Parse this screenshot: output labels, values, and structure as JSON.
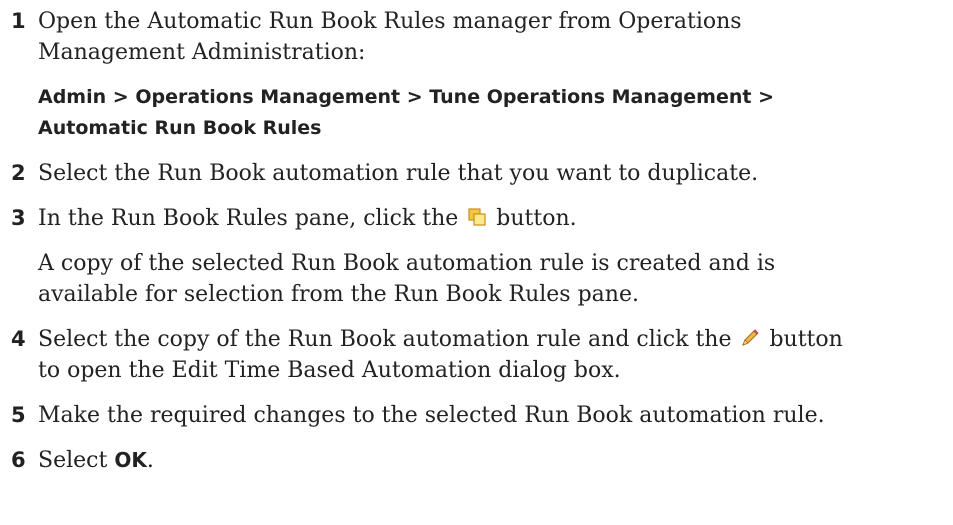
{
  "steps": [
    {
      "num": "1",
      "text_line1": "Open the Automatic Run Book Rules manager from Operations",
      "text_line2": "Management Administration:",
      "path": {
        "a": "Admin",
        "sep": " > ",
        "b": "Operations Management",
        "c": "Tune Operations Management",
        "d": "Automatic Run Book Rules"
      }
    },
    {
      "num": "2",
      "text": "Select the Run Book automation rule that you want to duplicate."
    },
    {
      "num": "3",
      "text_before": "In the Run Book Rules pane, click the ",
      "icon": "duplicate-icon",
      "text_after": " button.",
      "note_line1": "A copy of the selected Run Book automation rule is created and is",
      "note_line2": "available for selection from the Run Book Rules pane."
    },
    {
      "num": "4",
      "text_before": "Select the copy of the Run Book automation rule and click the ",
      "icon": "edit-pencil-icon",
      "text_after": " button",
      "text_line2": "to open the Edit Time Based Automation dialog box."
    },
    {
      "num": "5",
      "text": "Make the required changes to the selected Run Book automation rule."
    },
    {
      "num": "6",
      "text_before": "Select ",
      "bold": "OK",
      "text_after": "."
    }
  ]
}
